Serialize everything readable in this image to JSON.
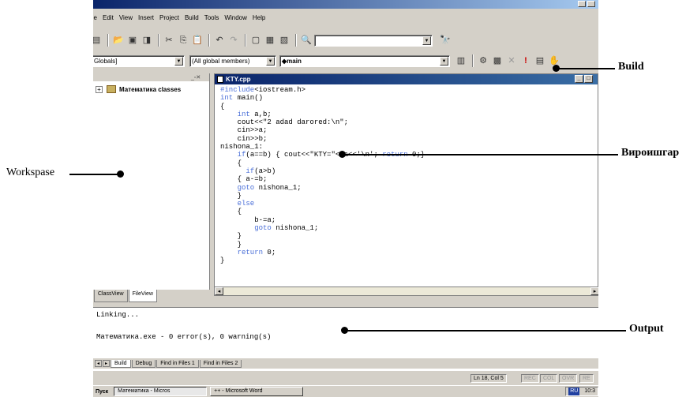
{
  "menu": [
    "ile",
    "Edit",
    "View",
    "Insert",
    "Project",
    "Build",
    "Tools",
    "Window",
    "Help"
  ],
  "toolbar2": {
    "globals": "Globals]",
    "members": "(All global members)",
    "function": "◆main"
  },
  "workspace": {
    "tree_item": "Математика classes",
    "tabs": [
      "ClassView",
      "FileView"
    ]
  },
  "editor": {
    "filename": "KTY.cpp",
    "code_lines": [
      "#include<iostream.h>",
      "int main()",
      "{",
      "    int a,b;",
      "    cout<<\"2 adad darored:\\n\";",
      "    cin>>a;",
      "    cin>>b;",
      "nishona_1:",
      "    if(a==b) { cout<<\"KTY=\"<<a<<'\\n'; return 0;}",
      "    {",
      "      if(a>b)",
      "    { a-=b;",
      "    goto nishona_1;",
      "    }",
      "    else",
      "    {",
      "        b-=a;",
      "        goto nishona_1;",
      "    }",
      "    }",
      "    return 0;",
      "}"
    ]
  },
  "output": {
    "lines": [
      "Linking...",
      "",
      "Математика.exe - 0 error(s), 0 warning(s)"
    ],
    "tabs": [
      "Build",
      "Debug",
      "Find in Files 1",
      "Find in Files 2"
    ]
  },
  "status": {
    "position": "Ln 18, Col 5",
    "indicators": [
      "REC",
      "COL",
      "OVR",
      "RE"
    ]
  },
  "taskbar": {
    "start": "Пуск",
    "buttons": [
      "Математика - Micros",
      "++ - Microsoft Word"
    ],
    "clock": "10:3"
  },
  "annotations": {
    "build": "Build",
    "editor": "Вироишгар",
    "workspace": "Workspase",
    "output": "Output"
  }
}
